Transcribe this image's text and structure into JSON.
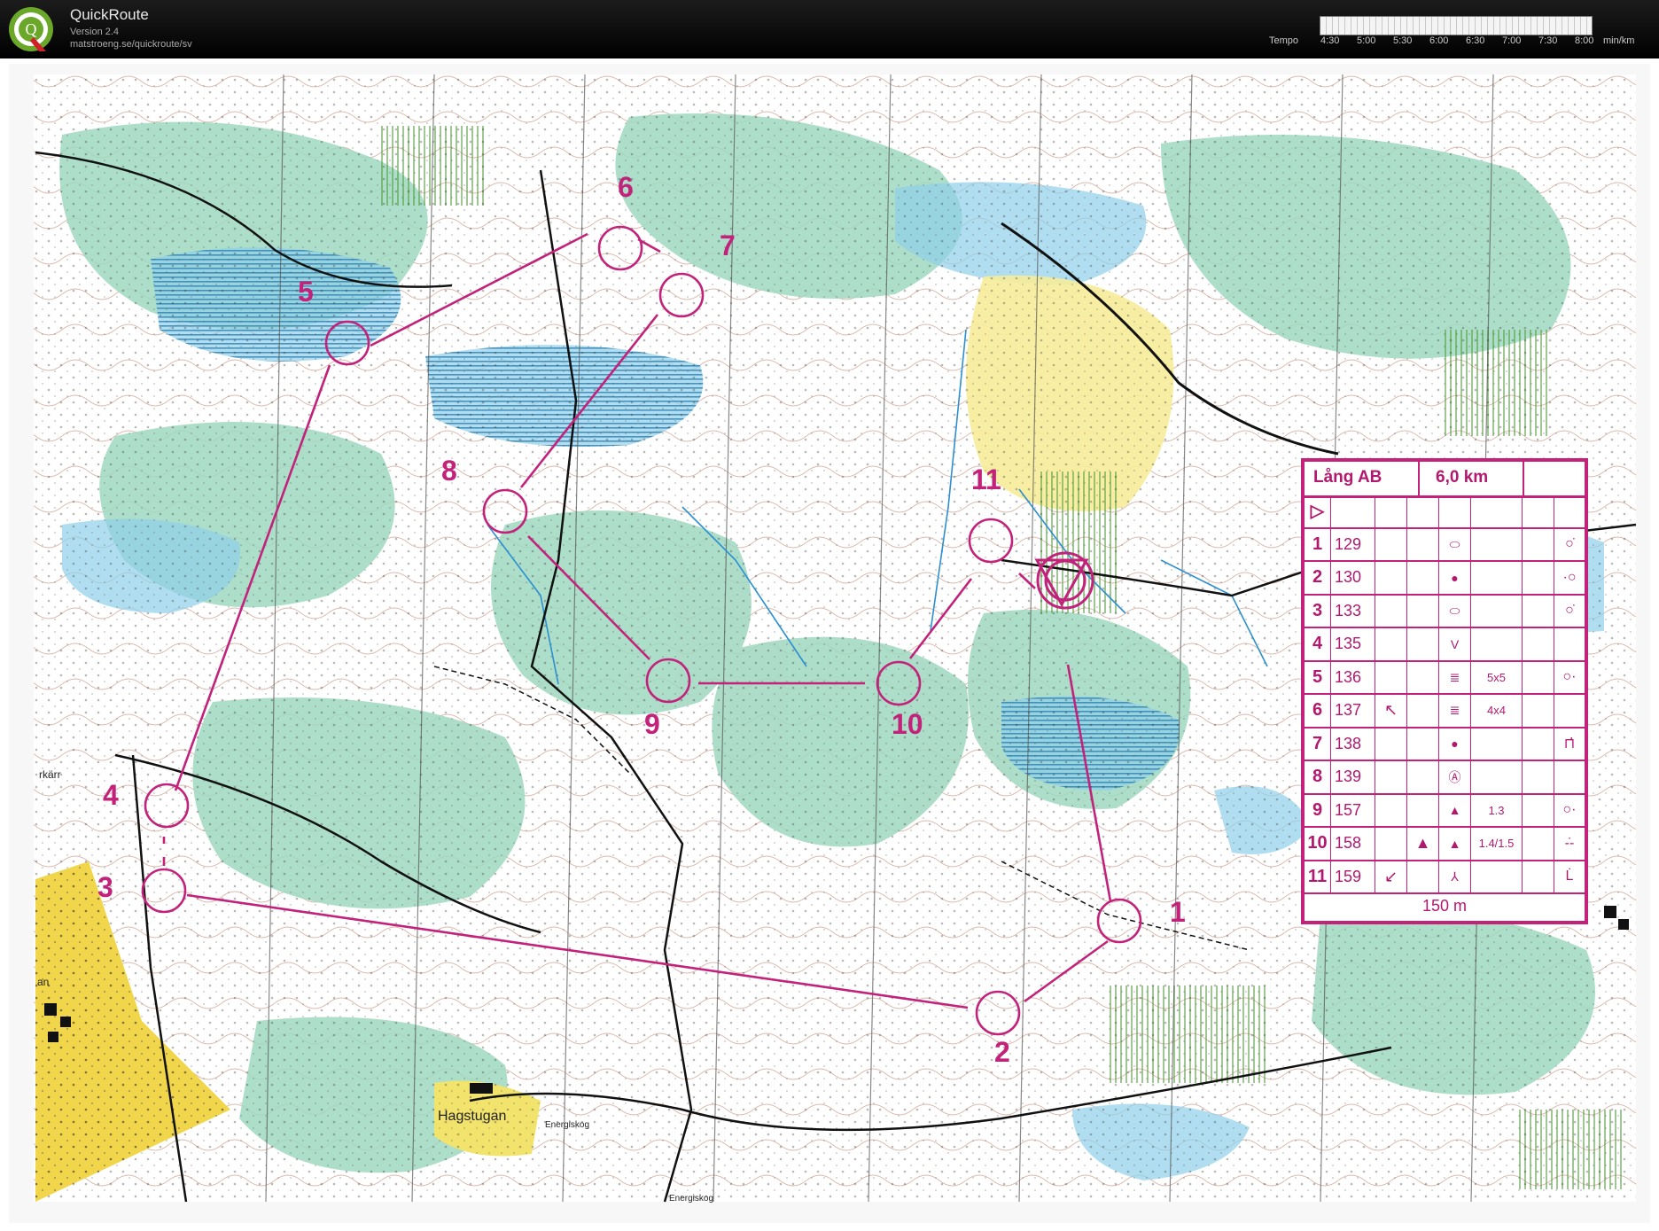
{
  "header": {
    "app_title": "QuickRoute",
    "version": "Version 2.4",
    "url": "matstroeng.se/quickroute/sv",
    "tempo_label": "Tempo",
    "tempo_ticks": [
      "4:30",
      "5:00",
      "5:30",
      "6:00",
      "6:30",
      "7:00",
      "7:30",
      "8:00",
      "min/km"
    ],
    "logo_letter": "Q"
  },
  "map": {
    "course_color": "#c2227a",
    "place_labels": {
      "hagstugan": "Hagstugan",
      "energiskog_1": "Energiskog",
      "energiskog_2": "Energiskog",
      "karr": "rkärr",
      "an": "an"
    },
    "control_numbers": [
      "1",
      "2",
      "3",
      "4",
      "5",
      "6",
      "7",
      "8",
      "9",
      "10",
      "11"
    ]
  },
  "control_description": {
    "course_name": "Lång AB",
    "course_length": "6,0 km",
    "start_symbol": "▷",
    "rows": [
      {
        "num": "1",
        "code": "129",
        "c": "",
        "d": "",
        "e": "⬭",
        "f": "",
        "g": "",
        "h": "○̇"
      },
      {
        "num": "2",
        "code": "130",
        "c": "",
        "d": "",
        "e": "●",
        "f": "",
        "g": "",
        "h": "·○"
      },
      {
        "num": "3",
        "code": "133",
        "c": "",
        "d": "",
        "e": "⬭",
        "f": "",
        "g": "",
        "h": "○̇"
      },
      {
        "num": "4",
        "code": "135",
        "c": "",
        "d": "",
        "e": "V",
        "f": "",
        "g": "",
        "h": ""
      },
      {
        "num": "5",
        "code": "136",
        "c": "",
        "d": "",
        "e": "≣",
        "f": "5x5",
        "g": "",
        "h": "○·"
      },
      {
        "num": "6",
        "code": "137",
        "c": "↖",
        "d": "",
        "e": "≣",
        "f": "4x4",
        "g": "",
        "h": ""
      },
      {
        "num": "7",
        "code": "138",
        "c": "",
        "d": "",
        "e": "●",
        "f": "",
        "g": "",
        "h": "⊓̇"
      },
      {
        "num": "8",
        "code": "139",
        "c": "",
        "d": "",
        "e": "Ⓐ",
        "f": "",
        "g": "",
        "h": ""
      },
      {
        "num": "9",
        "code": "157",
        "c": "",
        "d": "",
        "e": "▲",
        "f": "1.3",
        "g": "",
        "h": "○·"
      },
      {
        "num": "10",
        "code": "158",
        "c": "",
        "d": "▲",
        "e": "▲",
        "f": "1.4/1.5",
        "g": "",
        "h": "-̇-"
      },
      {
        "num": "11",
        "code": "159",
        "c": "↙",
        "d": "",
        "e": "⅄",
        "f": "",
        "g": "",
        "h": "L̇"
      }
    ],
    "footer": "150 m"
  }
}
